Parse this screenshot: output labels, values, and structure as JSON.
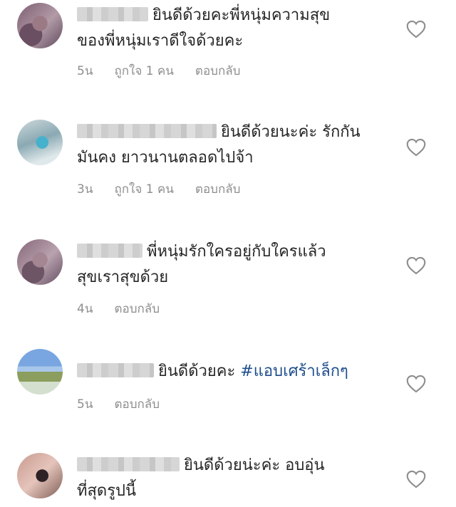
{
  "comments": [
    {
      "avatar_icon": "profile-avatar-pixelated",
      "line1": "ยินดีด้วยคะพี่หนุ่มความสุข",
      "line2": "ของพี่หนุ่มเราดีใจด้วยคะ",
      "hashtag": "",
      "time": "5น",
      "likes": "ถูกใจ 1 คน",
      "reply": "ตอบกลับ"
    },
    {
      "avatar_icon": "profile-avatar-pixelated",
      "line1": "ยินดีด้วยนะค่ะ รักกัน",
      "line2": "มันคง ยาวนานตลอดไปจ้า",
      "hashtag": "",
      "time": "3น",
      "likes": "ถูกใจ 1 คน",
      "reply": "ตอบกลับ"
    },
    {
      "avatar_icon": "profile-avatar-pixelated",
      "line1": "พี่หนุ่มรักใครอยู่กับใครแล้ว",
      "line2": "สุขเราสุขด้วย",
      "hashtag": "",
      "time": "4น",
      "likes": "",
      "reply": "ตอบกลับ"
    },
    {
      "avatar_icon": "profile-avatar-pixelated",
      "line1": "ยินดีด้วยคะ ",
      "line2": "",
      "hashtag": "#แอบเศร้าเล็กๆ",
      "time": "5น",
      "likes": "",
      "reply": "ตอบกลับ"
    },
    {
      "avatar_icon": "profile-avatar-pixelated",
      "line1": "ยินดีด้วยน่ะค่ะ อบอุ่น",
      "line2": "ที่สุดรูปนี้",
      "hashtag": "",
      "time": "",
      "likes": "",
      "reply": ""
    }
  ],
  "colors": {
    "text": "#262626",
    "meta": "#8e8e8e",
    "hashtag": "#1d4d8c",
    "heart_outline": "#8e8e8e"
  },
  "icons": {
    "like": "heart-outline-icon"
  }
}
